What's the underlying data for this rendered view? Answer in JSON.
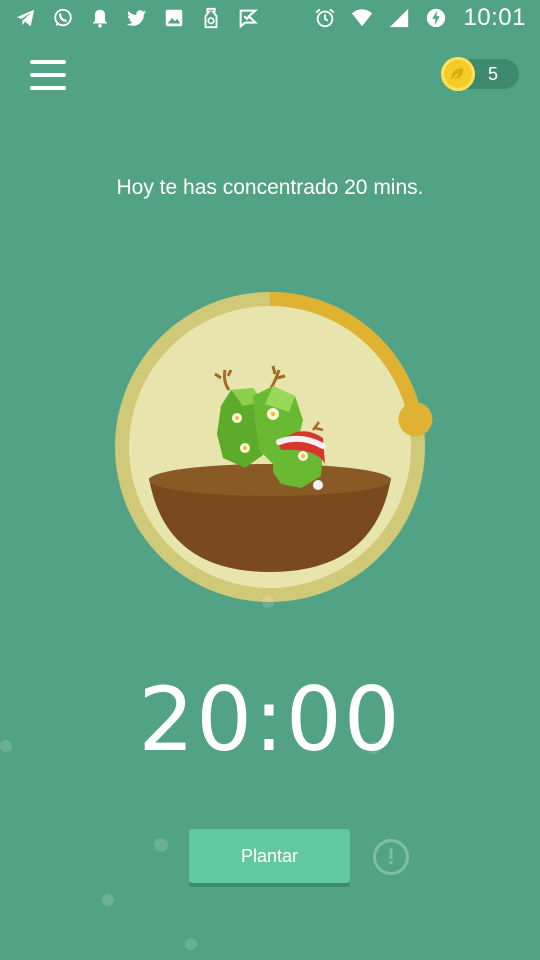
{
  "status_bar": {
    "time": "10:01",
    "left_icons": [
      "telegram-icon",
      "whatsapp-icon",
      "bell-icon",
      "twitter-icon",
      "image-icon",
      "app-notification-icon",
      "check-flag-icon"
    ],
    "right_icons": [
      "alarm-icon",
      "wifi-icon",
      "signal-icon",
      "battery-charging-icon"
    ]
  },
  "header": {
    "menu_icon": "hamburger-menu-icon",
    "coins": {
      "count": "5",
      "icon": "coin-leaf-icon"
    }
  },
  "main": {
    "today_text": "Hoy te has concentrado 20 mins.",
    "progress_fraction": 0.22,
    "timer": "20:00",
    "plant_button_label": "Plantar",
    "info_icon": "exclamation-circle-icon"
  },
  "colors": {
    "background": "#52a386",
    "ring_outer": "#cfc978",
    "ring_inner": "#e8e4ad",
    "progress": "#dfb232",
    "soil": "#7a4a1e",
    "button": "#62c8a2",
    "coin": "#f4cc26"
  }
}
